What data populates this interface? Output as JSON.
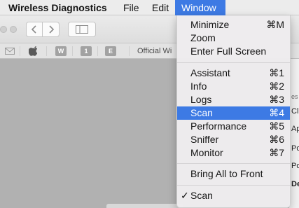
{
  "menubar": {
    "app": "Wireless Diagnostics",
    "items": [
      "File",
      "Edit",
      "Window"
    ]
  },
  "toolbar": {
    "back_icon": "chevron-left-icon",
    "forward_icon": "chevron-right-icon",
    "sidebar_icon": "sidebar-icon"
  },
  "favorites": {
    "mail_icon": "envelope-icon",
    "apple_icon": "apple-icon",
    "tiles": [
      "W",
      "1",
      "E"
    ],
    "official_label": "Official Wi"
  },
  "background_fragments": {
    "es": "es",
    "cl": "Cl",
    "ap": "Ap",
    "po1": "Po",
    "po2": "Po",
    "de": "De"
  },
  "window_menu": {
    "groups": [
      [
        {
          "label": "Minimize",
          "shortcut": "⌘M"
        },
        {
          "label": "Zoom",
          "shortcut": ""
        },
        {
          "label": "Enter Full Screen",
          "shortcut": ""
        }
      ],
      [
        {
          "label": "Assistant",
          "shortcut": "⌘1"
        },
        {
          "label": "Info",
          "shortcut": "⌘2"
        },
        {
          "label": "Logs",
          "shortcut": "⌘3"
        },
        {
          "label": "Scan",
          "shortcut": "⌘4",
          "highlighted": true
        },
        {
          "label": "Performance",
          "shortcut": "⌘5"
        },
        {
          "label": "Sniffer",
          "shortcut": "⌘6"
        },
        {
          "label": "Monitor",
          "shortcut": "⌘7"
        }
      ],
      [
        {
          "label": "Bring All to Front",
          "shortcut": ""
        }
      ],
      [
        {
          "label": "Scan",
          "shortcut": "",
          "checked": true,
          "check_mark": "✓"
        }
      ]
    ]
  },
  "colors": {
    "highlight": "#3d7ae4",
    "menu_bg": "#eeecee"
  }
}
